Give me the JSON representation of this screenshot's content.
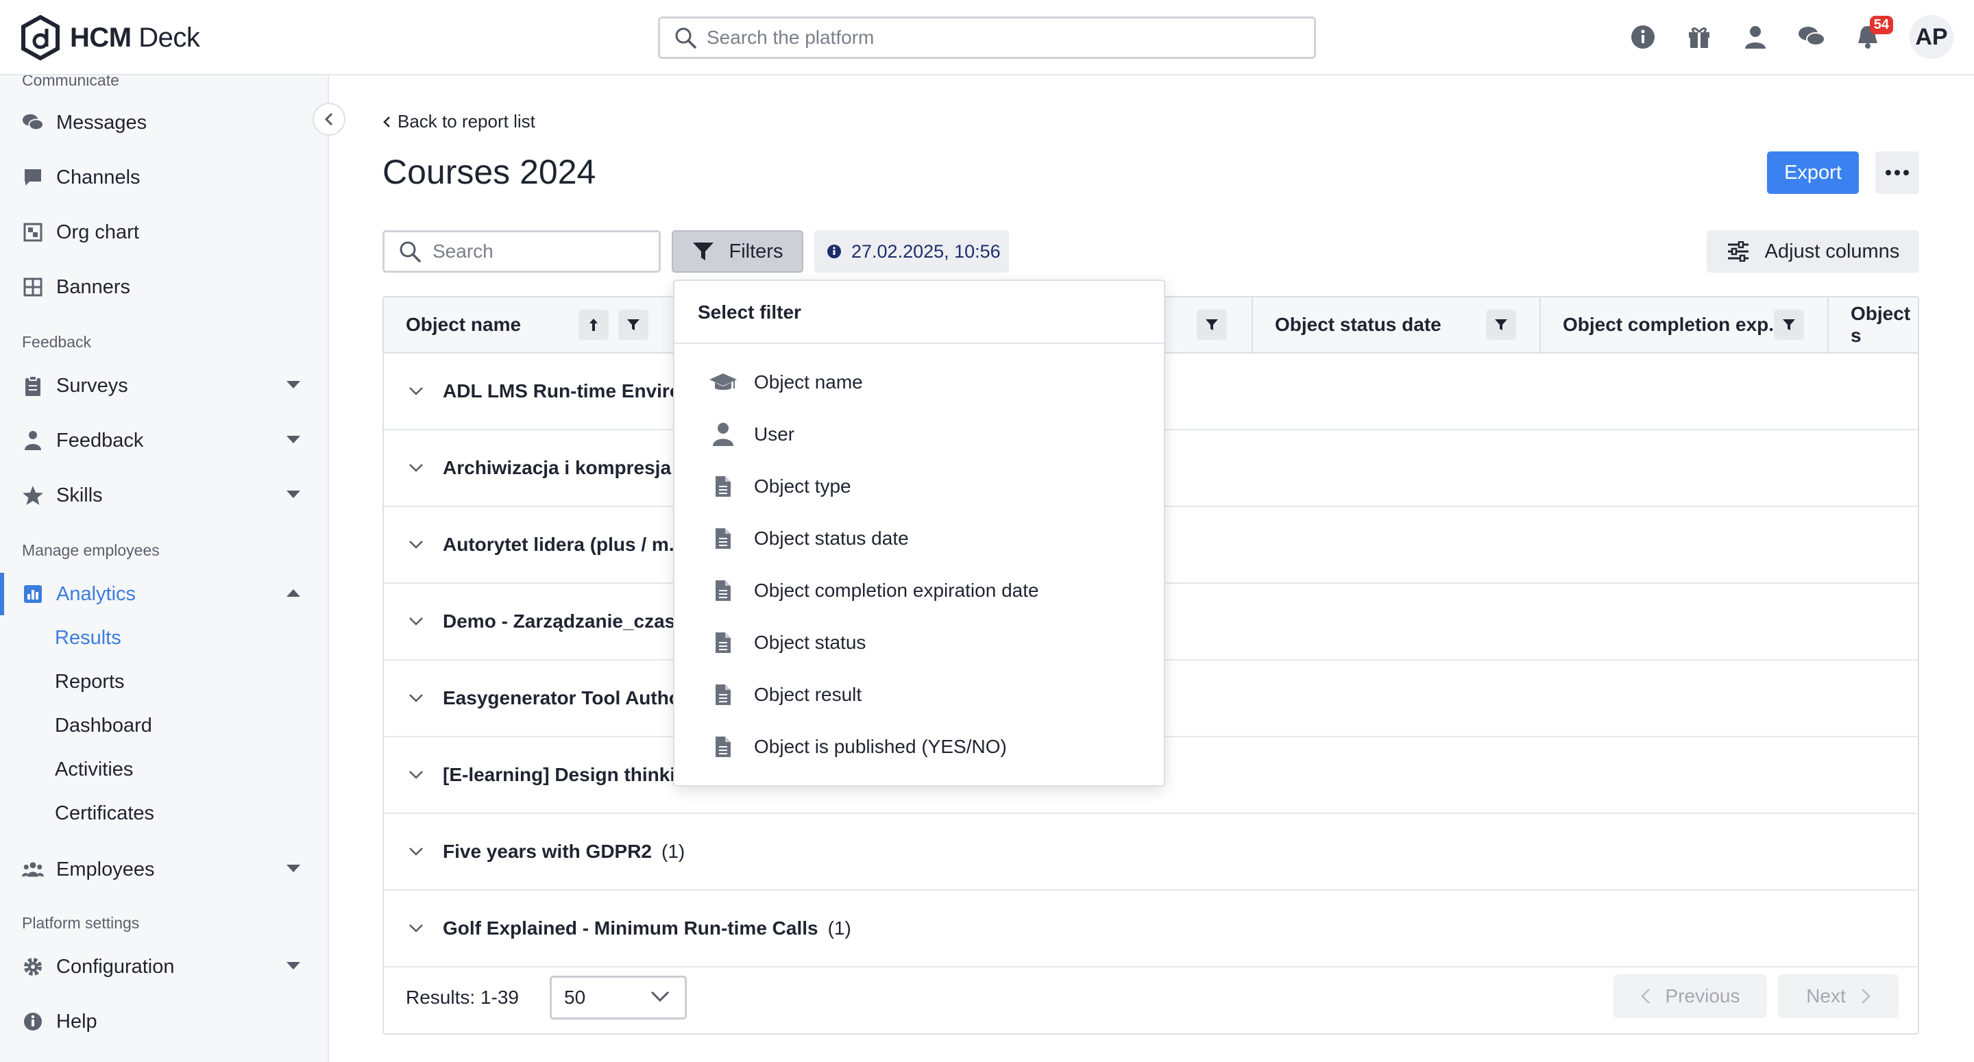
{
  "app": {
    "name_bold": "HCM",
    "name_light": "Deck"
  },
  "global_search": {
    "placeholder": "Search the platform"
  },
  "topbar": {
    "notification_count": "54",
    "avatar_initials": "AP"
  },
  "sidebar": {
    "cut_off_section": "Communicate",
    "items_communicate": [
      "Messages",
      "Channels",
      "Org chart",
      "Banners"
    ],
    "section_feedback": "Feedback",
    "items_feedback": [
      "Surveys",
      "Feedback",
      "Skills"
    ],
    "section_manage": "Manage employees",
    "analytics": "Analytics",
    "analytics_sub": [
      "Results",
      "Reports",
      "Dashboard",
      "Activities",
      "Certificates"
    ],
    "employees": "Employees",
    "section_platform": "Platform settings",
    "configuration": "Configuration",
    "help": "Help"
  },
  "page": {
    "back_link": "Back to report list",
    "title": "Courses 2024",
    "export": "Export"
  },
  "toolbar": {
    "search_placeholder": "Search",
    "filters": "Filters",
    "date": "27.02.2025, 10:56",
    "adjust_columns": "Adjust columns"
  },
  "table": {
    "columns": [
      "Object name",
      "Object status date",
      "Object completion exp...",
      "Object s"
    ],
    "rows": [
      {
        "label": "ADL LMS Run-time Environ",
        "count": ""
      },
      {
        "label": "Archiwizacja i kompresja",
        "count": "("
      },
      {
        "label": "Autorytet lidera (plus / m.g",
        "count": ""
      },
      {
        "label": "Demo - Zarządzanie_czase",
        "count": ""
      },
      {
        "label": "Easygenerator Tool Author",
        "count": ""
      },
      {
        "label": "[E-learning] Design thinkin",
        "count": ""
      },
      {
        "label": "Five years with GDPR2",
        "count": "(1)"
      },
      {
        "label": "Golf Explained - Minimum Run-time Calls",
        "count": "(1)"
      }
    ],
    "results": "Results: 1-39",
    "page_size": "50",
    "previous": "Previous",
    "next": "Next"
  },
  "filter_menu": {
    "title": "Select filter",
    "items": [
      {
        "label": "Object name",
        "icon": "graduation-cap-icon"
      },
      {
        "label": "User",
        "icon": "user-icon"
      },
      {
        "label": "Object type",
        "icon": "document-icon"
      },
      {
        "label": "Object status date",
        "icon": "document-icon"
      },
      {
        "label": "Object completion expiration date",
        "icon": "document-icon"
      },
      {
        "label": "Object status",
        "icon": "document-icon"
      },
      {
        "label": "Object result",
        "icon": "document-icon"
      },
      {
        "label": "Object is published (YES/NO)",
        "icon": "document-icon"
      }
    ]
  },
  "colors": {
    "accent": "#3b82f0",
    "active_nav": "#3b7ddd",
    "badge": "#e3342f"
  }
}
